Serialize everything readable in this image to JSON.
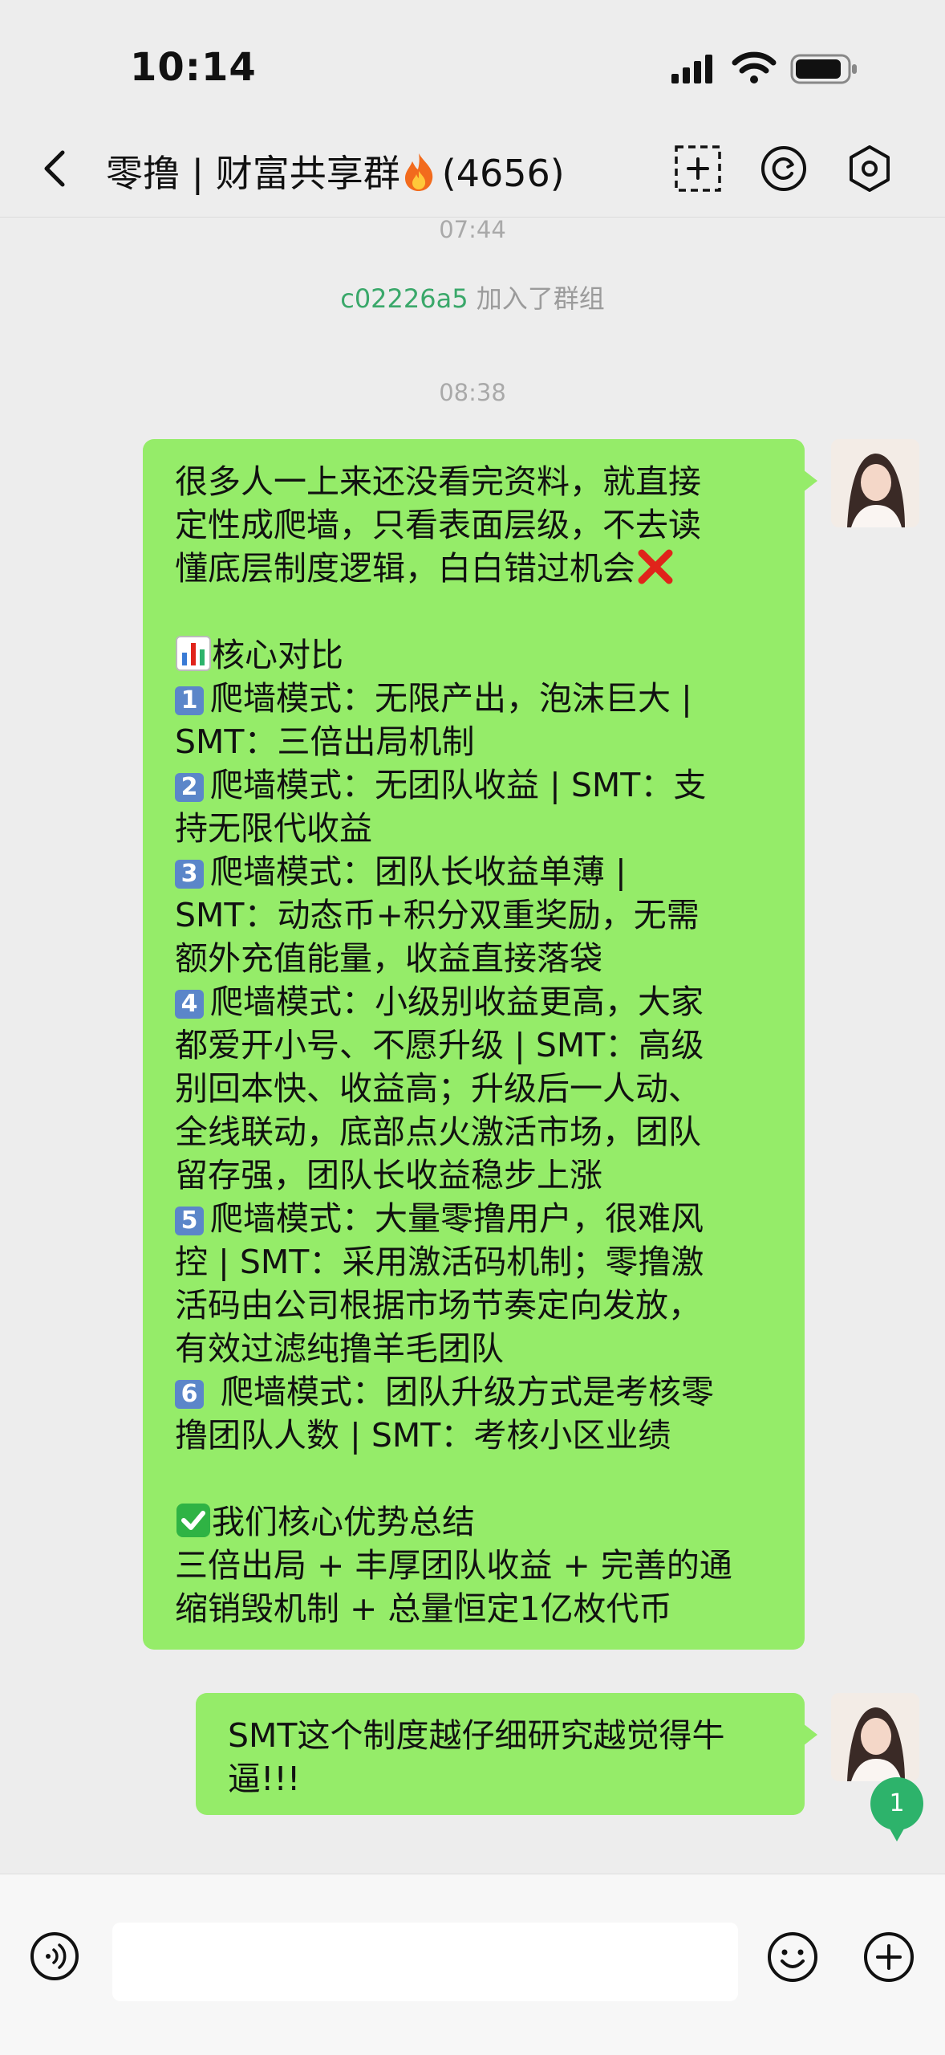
{
  "status_bar": {
    "time": "10:14"
  },
  "nav": {
    "title": "零撸 | 财富共享群",
    "member_count": "(4656)"
  },
  "chat": {
    "time_1": "07:44",
    "join_user": "c02226a5",
    "join_text": " 加入了群组",
    "time_2": "08:38",
    "message_1": {
      "intro_1": "很多人一上来还没看完资料，就直接",
      "intro_2": "定性成爬墙，只看表面层级，不去读",
      "intro_3": "懂底层制度逻辑，白白错过机会",
      "heading_compare": "核心对比",
      "p1_a": "爬墙模式：无限产出，泡沫巨大 |",
      "p1_b": "SMT：三倍出局机制",
      "p2_a": "爬墙模式：无团队收益 | SMT：支",
      "p2_b": "持无限代收益",
      "p3_a": "爬墙模式：团队长收益单薄 |",
      "p3_b": "SMT：动态币+积分双重奖励，无需",
      "p3_c": "额外充值能量，收益直接落袋",
      "p4_a": "爬墙模式：小级别收益更高，大家",
      "p4_b": "都爱开小号、不愿升级 | SMT：高级",
      "p4_c": "别回本快、收益高；升级后一人动、",
      "p4_d": "全线联动，底部点火激活市场，团队",
      "p4_e": "留存强，团队长收益稳步上涨",
      "p5_a": "爬墙模式：大量零撸用户，很难风",
      "p5_b": "控 | SMT：采用激活码机制；零撸激",
      "p5_c": "活码由公司根据市场节奏定向发放，",
      "p5_d": "有效过滤纯撸羊毛团队",
      "p6_a": " 爬墙模式：团队升级方式是考核零",
      "p6_b": "撸团队人数 | SMT：考核小区业绩",
      "heading_summary": "我们核心优势总结",
      "sum_1": "三倍出局 + 丰厚团队收益 + 完善的通",
      "sum_2": "缩销毁机制 + 总量恒定1亿枚代币"
    },
    "message_2": {
      "line_1": "SMT这个制度越仔细研究越觉得牛",
      "line_2": "逼!!!"
    },
    "unread_count": "1"
  },
  "keycaps": [
    "1",
    "2",
    "3",
    "4",
    "5",
    "6"
  ],
  "colors": {
    "bubble": "#95ec69",
    "background": "#ededed",
    "join_name": "#3aa86a",
    "badge": "#2db36b"
  },
  "icons": [
    "back-icon",
    "add-member-icon",
    "refresh-icon",
    "settings-icon",
    "voice-icon",
    "emoji-icon",
    "plus-icon",
    "fire-icon",
    "cross-mark-icon",
    "bar-chart-icon",
    "check-mark-icon"
  ]
}
